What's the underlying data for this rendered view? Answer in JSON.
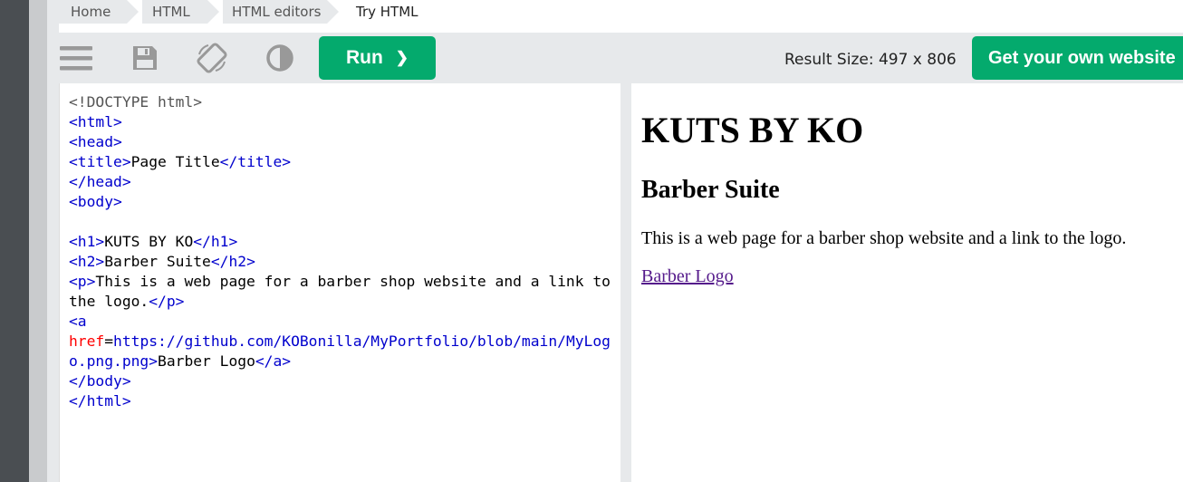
{
  "breadcrumb": {
    "items": [
      "Home",
      "HTML",
      "HTML editors",
      "Try HTML"
    ]
  },
  "toolbar": {
    "icons": [
      "menu-icon",
      "save-icon",
      "rotate-icon",
      "contrast-icon"
    ],
    "run_label": "Run",
    "run_chevron": "❯",
    "result_size": "Result Size: 497 x 806",
    "own_site_label": "Get your own website",
    "accent": "#04aa6d"
  },
  "code": {
    "doctype": "<!DOCTYPE html>",
    "html_open": "<html>",
    "head_open": "<head>",
    "title_open": "<title>",
    "title_text": "Page Title",
    "title_close": "</title>",
    "head_close": "</head>",
    "body_open": "<body>",
    "h1_open": "<h1>",
    "h1_text": "KUTS BY KO",
    "h1_close": "</h1>",
    "h2_open": "<h2>",
    "h2_text": "Barber Suite",
    "h2_close": "</h2>",
    "p_open": "<p>",
    "p_text": "This is a web page for a barber shop website and a link to the logo.",
    "p_close": "</p>",
    "a_open": "<a",
    "href_attr": "href",
    "href_eq": "=",
    "href_value": "https://github.com/KOBonilla/MyPortfolio/blob/main/MyLogo.png.png",
    "a_gt": ">",
    "a_text": "Barber Logo",
    "a_close": "</a>",
    "body_close": "</body>",
    "html_close": "</html>"
  },
  "result": {
    "h1": "KUTS BY KO",
    "h2": "Barber Suite",
    "p": "This is a web page for a barber shop website and a link to the logo.",
    "link": "Barber Logo"
  }
}
